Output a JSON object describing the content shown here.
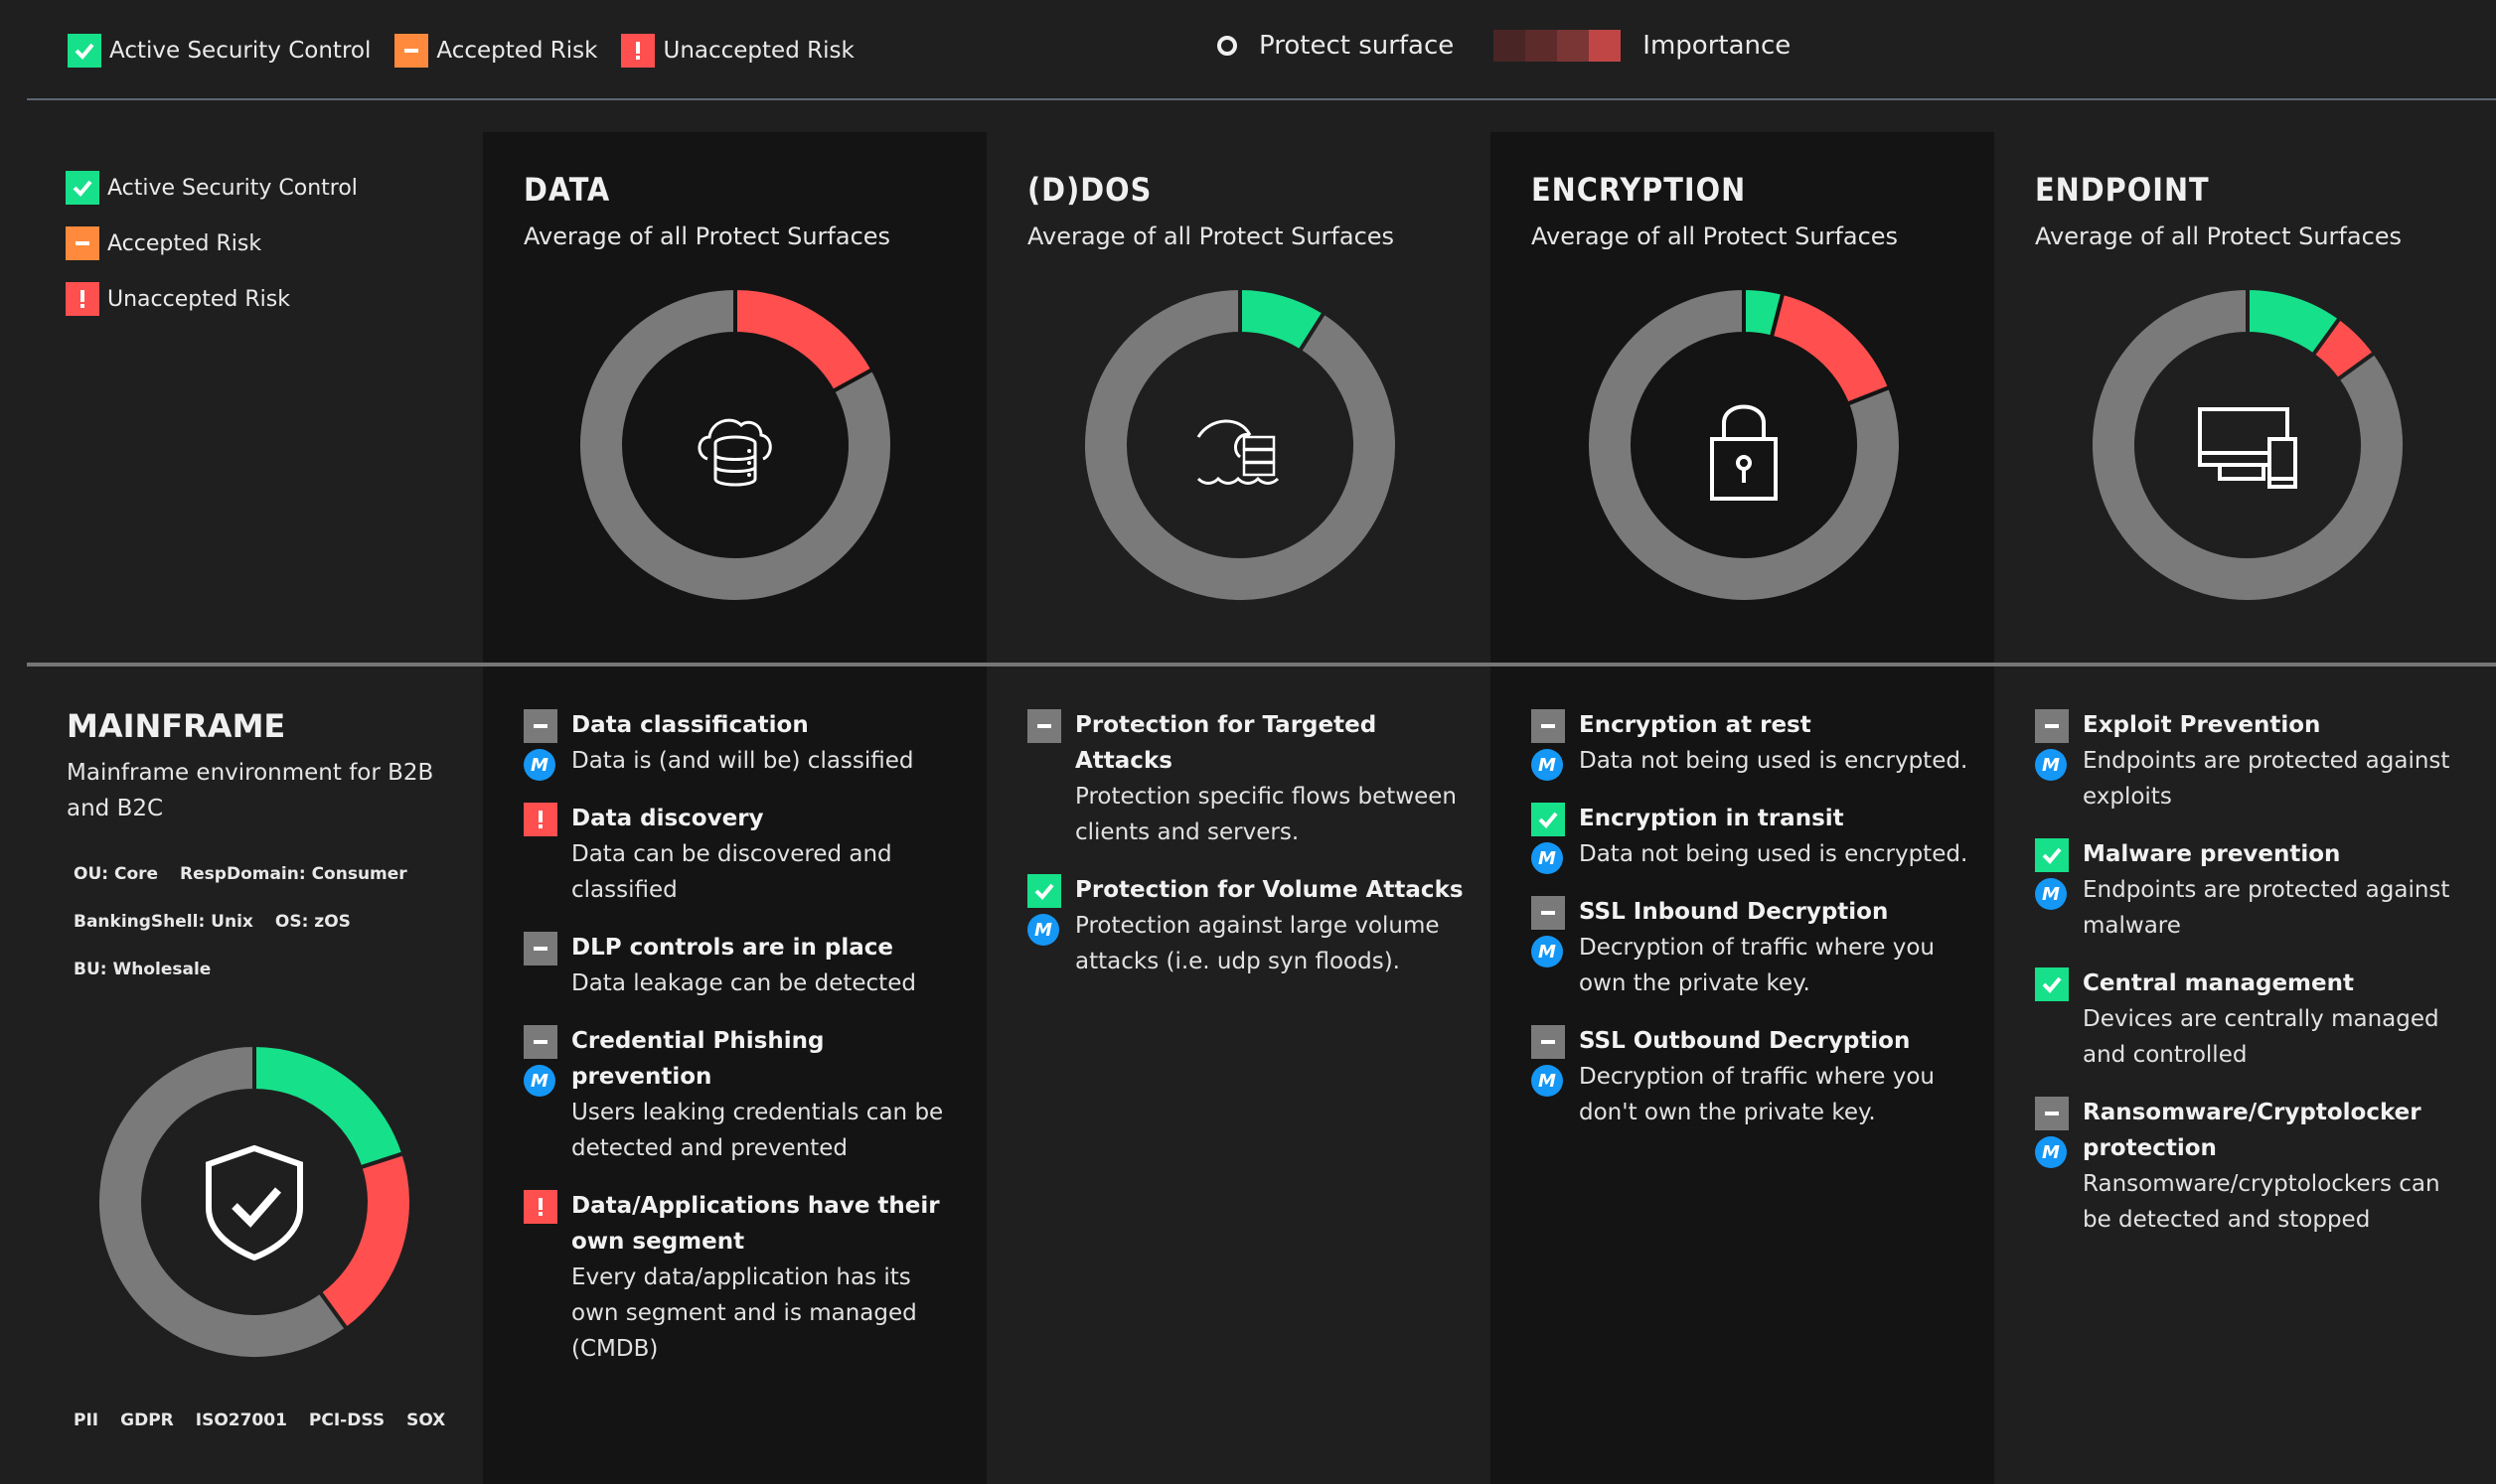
{
  "colors": {
    "active": "#16e08a",
    "accepted": "#ff8a3d",
    "unaccepted": "#ff4f4f",
    "neutral": "#7a7a7a",
    "m_badge": "#1497f5"
  },
  "top_legend": {
    "items": [
      {
        "label": "Active Security Control",
        "status": "active",
        "icon": "check-icon"
      },
      {
        "label": "Accepted Risk",
        "status": "accepted",
        "icon": "minus-icon"
      },
      {
        "label": "Unaccepted Risk",
        "status": "unaccepted",
        "icon": "exclamation-icon"
      }
    ],
    "protect_surface_label": "Protect surface",
    "importance_label": "Importance",
    "importance_scale": [
      "#4a2525",
      "#5e2b2b",
      "#7a3535",
      "#c04646"
    ]
  },
  "side_legend": {
    "items": [
      {
        "label": "Active Security Control",
        "status": "active"
      },
      {
        "label": "Accepted Risk",
        "status": "accepted"
      },
      {
        "label": "Unaccepted Risk",
        "status": "unaccepted"
      }
    ]
  },
  "categories": [
    {
      "title": "DATA",
      "subtitle": "Average of all Protect Surfaces",
      "icon": "cloud-database-icon",
      "items": [
        {
          "status": "neutral",
          "title": "Data classification",
          "desc": "Data is (and will be) classified",
          "m": true
        },
        {
          "status": "unaccepted",
          "title": "Data discovery",
          "desc": "Data can be discovered and classified",
          "m": false
        },
        {
          "status": "neutral",
          "title": "DLP controls are in place",
          "desc": "Data leakage can be detected",
          "m": false
        },
        {
          "status": "neutral",
          "title": "Credential Phishing prevention",
          "desc": "Users leaking credentials can be detected and prevented",
          "m": true
        },
        {
          "status": "unaccepted",
          "title": "Data/Applications have their own segment",
          "desc": "Every data/application has its own segment and is managed (CMDB)",
          "m": false
        }
      ]
    },
    {
      "title": "(D)DOS",
      "subtitle": "Average of all Protect Surfaces",
      "icon": "wave-server-icon",
      "items": [
        {
          "status": "neutral",
          "title": "Protection for Targeted Attacks",
          "desc": "Protection specific flows between clients and servers.",
          "m": false
        },
        {
          "status": "active",
          "title": "Protection for Volume Attacks",
          "desc": "Protection against large volume attacks (i.e. udp syn floods).",
          "m": true
        }
      ]
    },
    {
      "title": "ENCRYPTION",
      "subtitle": "Average of all Protect Surfaces",
      "icon": "padlock-icon",
      "items": [
        {
          "status": "neutral",
          "title": "Encryption at rest",
          "desc": "Data not being used is encrypted.",
          "m": true
        },
        {
          "status": "active",
          "title": "Encryption in transit",
          "desc": "Data not being used is encrypted.",
          "m": true
        },
        {
          "status": "neutral",
          "title": "SSL Inbound Decryption",
          "desc": "Decryption of traffic where you own the private key.",
          "m": true
        },
        {
          "status": "neutral",
          "title": "SSL Outbound Decryption",
          "desc": "Decryption of traffic where you don't own the private key.",
          "m": true
        }
      ]
    },
    {
      "title": "ENDPOINT",
      "subtitle": "Average of all Protect Surfaces",
      "icon": "monitor-phone-icon",
      "items": [
        {
          "status": "neutral",
          "title": "Exploit Prevention",
          "desc": "Endpoints are protected against exploits",
          "m": true
        },
        {
          "status": "active",
          "title": "Malware prevention",
          "desc": "Endpoints are protected against malware",
          "m": true
        },
        {
          "status": "active",
          "title": "Central management",
          "desc": "Devices are centrally managed and controlled",
          "m": false
        },
        {
          "status": "neutral",
          "title": "Ransomware/Cryptolocker protection",
          "desc": "Ransomware/cryptolockers can be detected and stopped",
          "m": true
        }
      ]
    }
  ],
  "mainframe": {
    "title": "MAINFRAME",
    "description": "Mainframe environment for B2B and B2C",
    "tag_rows": [
      [
        "OU: Core",
        "RespDomain: Consumer"
      ],
      [
        "BankingShell: Unix",
        "OS: zOS"
      ],
      [
        "BU: Wholesale"
      ]
    ],
    "compliance": [
      "PII",
      "GDPR",
      "ISO27001",
      "PCI-DSS",
      "SOX"
    ],
    "icon": "shield-check-icon"
  },
  "m_badge_label": "M",
  "chart_data": [
    {
      "type": "pie",
      "title": "DATA",
      "categories": [
        "Active Security Control",
        "Unaccepted Risk",
        "Other"
      ],
      "values": [
        0,
        17,
        83
      ]
    },
    {
      "type": "pie",
      "title": "(D)DOS",
      "categories": [
        "Active Security Control",
        "Unaccepted Risk",
        "Other"
      ],
      "values": [
        9,
        0,
        91
      ]
    },
    {
      "type": "pie",
      "title": "ENCRYPTION",
      "categories": [
        "Active Security Control",
        "Unaccepted Risk",
        "Other"
      ],
      "values": [
        4,
        15,
        81
      ]
    },
    {
      "type": "pie",
      "title": "ENDPOINT",
      "categories": [
        "Active Security Control",
        "Unaccepted Risk",
        "Other"
      ],
      "values": [
        10,
        5,
        85
      ]
    },
    {
      "type": "pie",
      "title": "MAINFRAME",
      "categories": [
        "Active Security Control",
        "Unaccepted Risk",
        "Other"
      ],
      "values": [
        20,
        20,
        60
      ]
    }
  ]
}
